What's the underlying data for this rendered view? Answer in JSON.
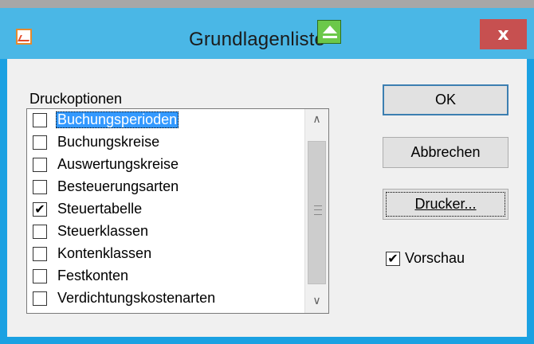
{
  "window": {
    "title": "Grundlagenliste",
    "close_label": "x"
  },
  "group": {
    "label": "Druckoptionen"
  },
  "options": [
    {
      "label": "Buchungsperioden",
      "checked": false,
      "selected": true
    },
    {
      "label": "Buchungskreise",
      "checked": false,
      "selected": false
    },
    {
      "label": "Auswertungskreise",
      "checked": false,
      "selected": false
    },
    {
      "label": "Besteuerungsarten",
      "checked": false,
      "selected": false
    },
    {
      "label": "Steuertabelle",
      "checked": true,
      "selected": false
    },
    {
      "label": "Steuerklassen",
      "checked": false,
      "selected": false
    },
    {
      "label": "Kontenklassen",
      "checked": false,
      "selected": false
    },
    {
      "label": "Festkonten",
      "checked": false,
      "selected": false
    },
    {
      "label": "Verdichtungskostenarten",
      "checked": false,
      "selected": false
    }
  ],
  "buttons": {
    "ok": "OK",
    "cancel": "Abbrechen",
    "printer": "Drucker..."
  },
  "preview": {
    "label": "Vorschau",
    "checked": true
  },
  "icons": {
    "app": "report-icon",
    "overlay": "eject-icon",
    "scroll_up": "chevron-up-icon",
    "scroll_down": "chevron-down-icon",
    "check_mark": "✔"
  },
  "colors": {
    "frame": "#1ba1e2",
    "selection": "#3399ff",
    "close": "#c75050"
  }
}
